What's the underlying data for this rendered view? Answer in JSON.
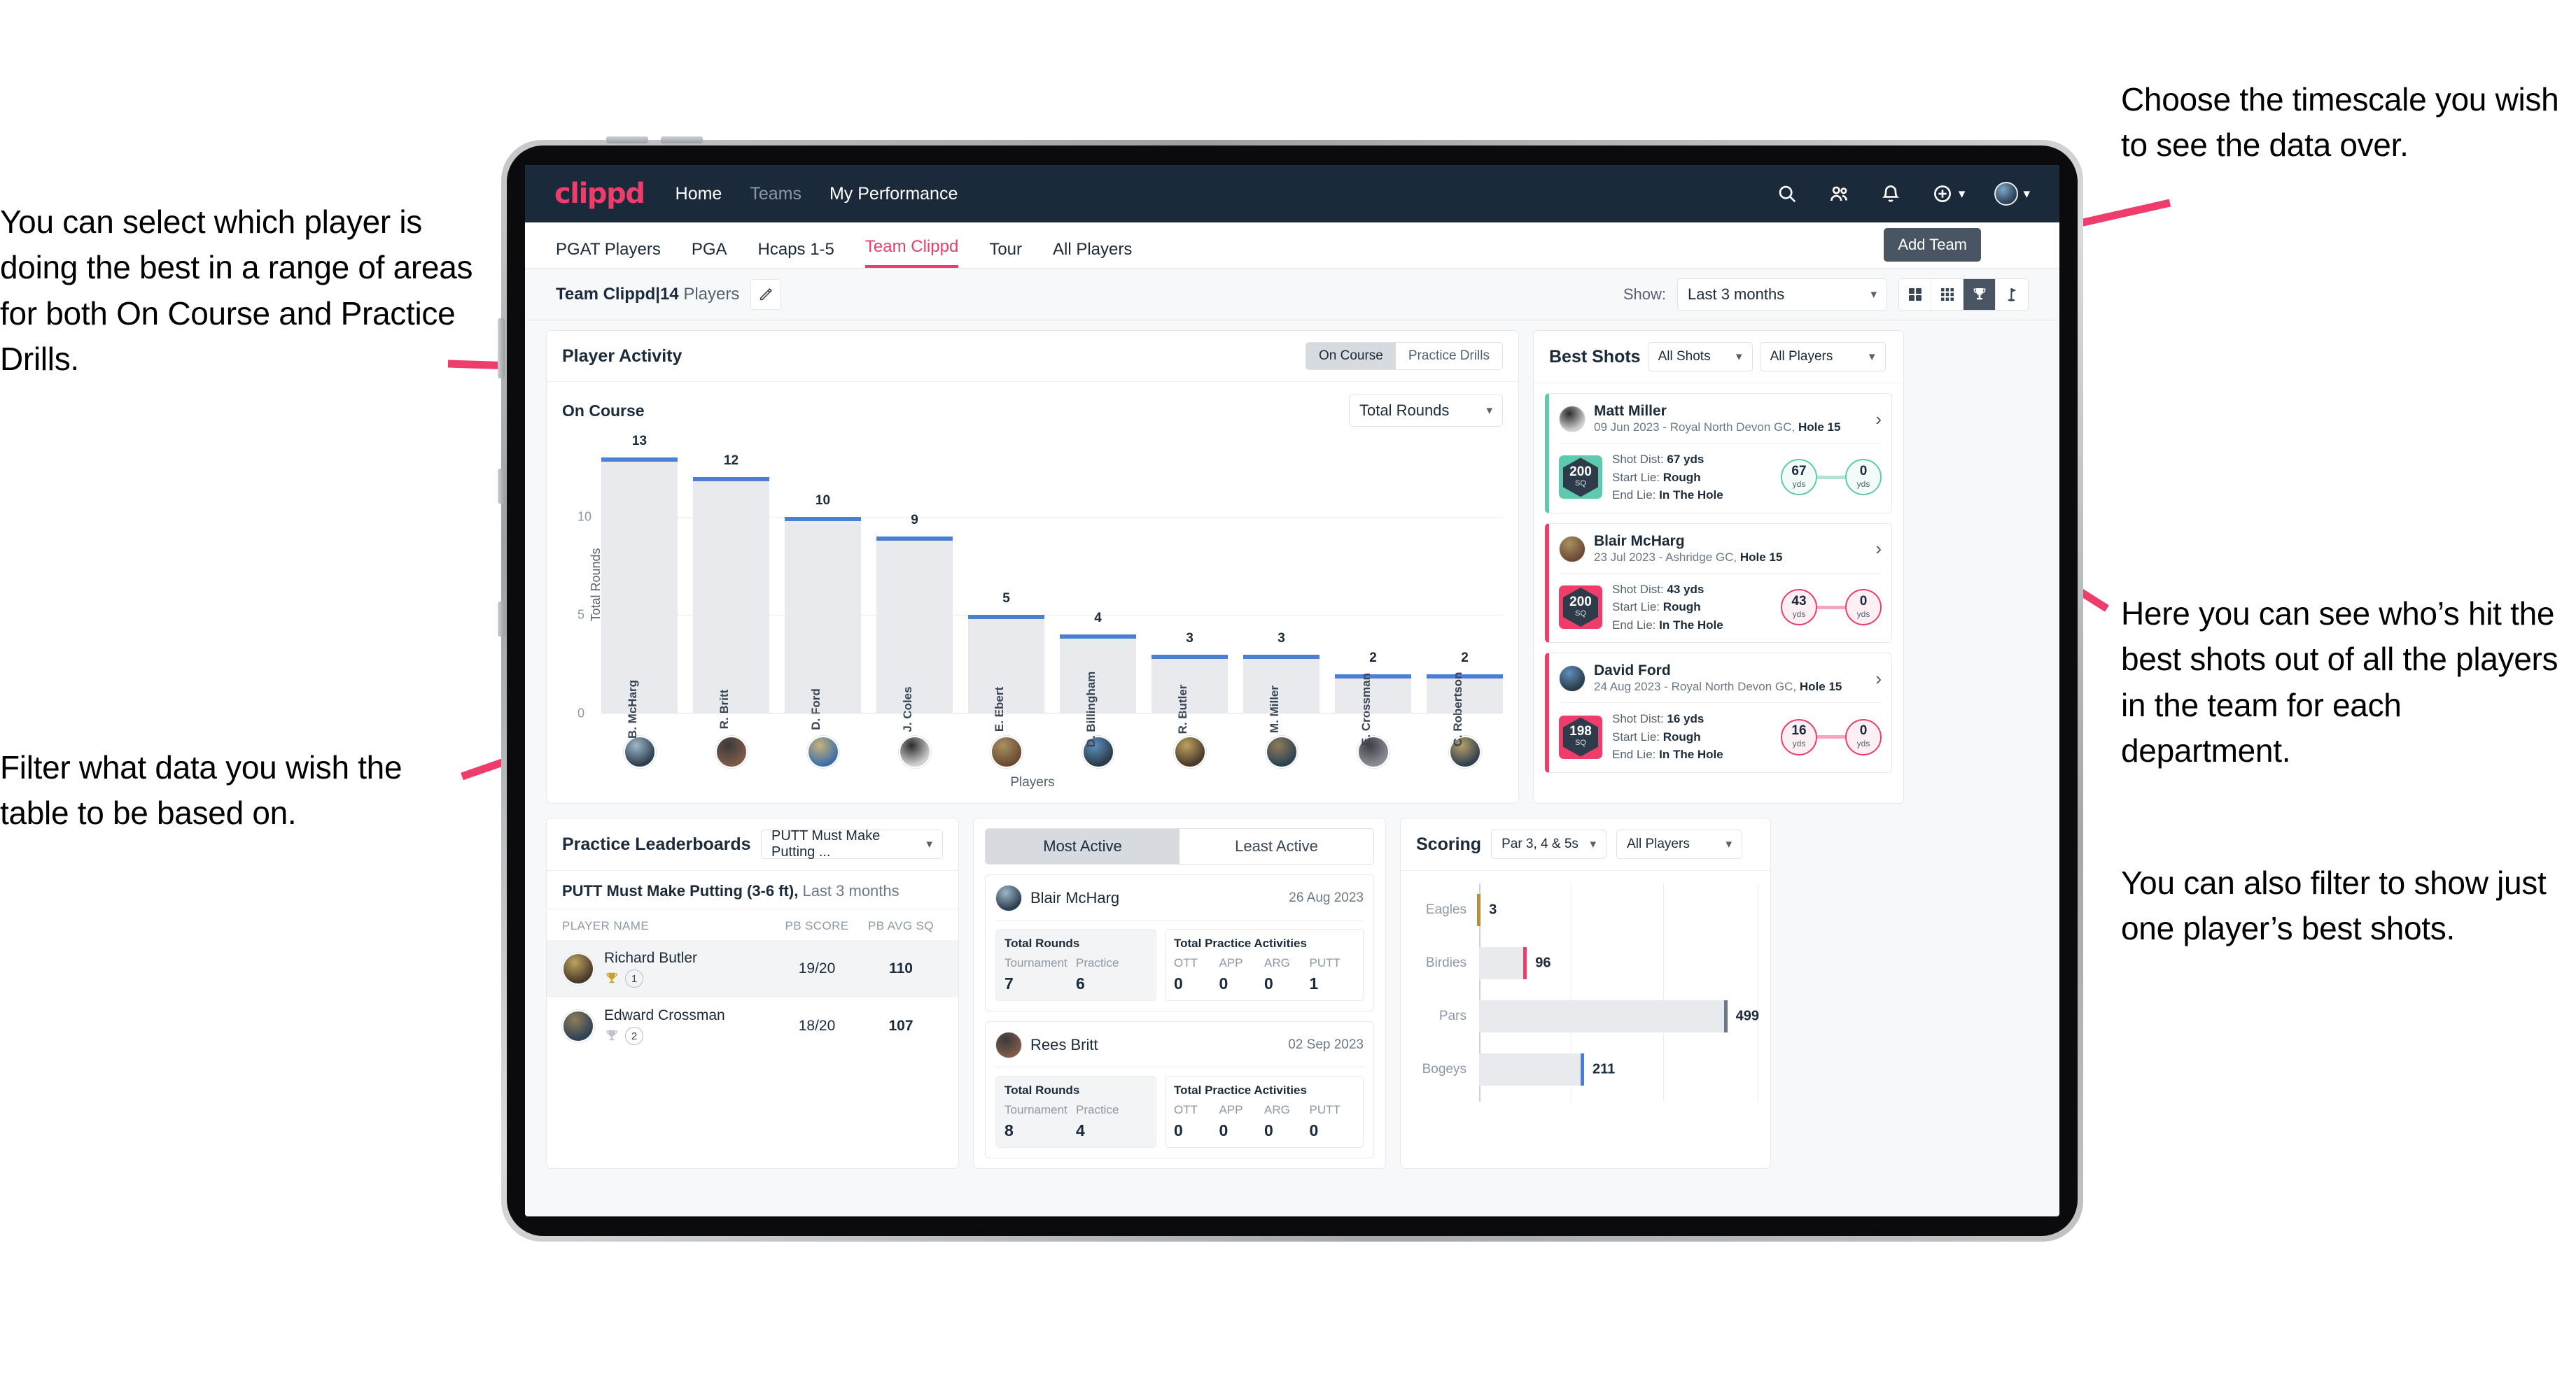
{
  "annotations": {
    "left_top": "You can select which player is doing the best in a range of areas for both On Course and Practice Drills.",
    "left_bottom": "Filter what data you wish the table to be based on.",
    "right_top": "Choose the timescale you wish to see the data over.",
    "right_middle": "Here you can see who’s hit the best shots out of all the players in the team for each department.",
    "right_bottom": "You can also filter to show just one player’s best shots."
  },
  "topnav": {
    "brand": "clippd",
    "links": [
      {
        "label": "Home",
        "active": true
      },
      {
        "label": "Teams",
        "active": false
      },
      {
        "label": "My Performance",
        "active": true
      }
    ],
    "icons": [
      "search-icon",
      "people-icon",
      "bell-icon",
      "plus-circle-icon",
      "avatar"
    ]
  },
  "subtabs": {
    "items": [
      {
        "label": "PGAT Players",
        "state": "normal"
      },
      {
        "label": "PGA",
        "state": "normal"
      },
      {
        "label": "Hcaps 1-5",
        "state": "normal"
      },
      {
        "label": "Team Clippd",
        "state": "active"
      },
      {
        "label": "Tour",
        "state": "normal"
      },
      {
        "label": "All Players",
        "state": "normal"
      }
    ],
    "tooltip": "Add Team"
  },
  "teambar": {
    "team_name": "Team Clippd",
    "separator": "|",
    "player_count": "14",
    "players_word": "Players",
    "edit_icon": "pencil-icon",
    "show_label": "Show:",
    "timescale_value": "Last 3 months",
    "view_icons": [
      "grid-large-icon",
      "grid-small-icon",
      "trophy-icon",
      "flag-icon"
    ],
    "active_view": "trophy-icon"
  },
  "player_activity": {
    "title": "Player Activity",
    "segments": [
      {
        "label": "On Course",
        "active": true
      },
      {
        "label": "Practice Drills",
        "active": false
      }
    ],
    "sub_label": "On Course",
    "metric_select": "Total Rounds"
  },
  "chart_data": {
    "type": "bar",
    "title": "Player Activity - On Course",
    "xlabel": "Players",
    "ylabel": "Total Rounds",
    "categories": [
      "B. McHarg",
      "R. Britt",
      "D. Ford",
      "J. Coles",
      "E. Ebert",
      "D. Billingham",
      "R. Butler",
      "M. Miller",
      "E. Crossman",
      "C. Robertson"
    ],
    "values": [
      13,
      12,
      10,
      9,
      5,
      4,
      3,
      3,
      2,
      2
    ],
    "yticks": [
      0,
      5,
      10
    ],
    "ylim": [
      0,
      14
    ],
    "grid": true,
    "legend": "none",
    "bar_color": "#e8eaee",
    "cap_color": "#4a7fd4"
  },
  "best_shots": {
    "title": "Best Shots",
    "filter_shots": "All Shots",
    "filter_players": "All Players",
    "shots": [
      {
        "player": "Matt Miller",
        "meta_date": "09 Jun 2023",
        "meta_course": "Royal North Devon GC,",
        "meta_hole": "Hole 15",
        "sq": "200",
        "sq_unit": "SQ",
        "shot_dist_label": "Shot Dist:",
        "shot_dist": "67 yds",
        "start_lie_label": "Start Lie:",
        "start_lie": "Rough",
        "end_lie_label": "End Lie:",
        "end_lie": "In The Hole",
        "from_value": "67",
        "from_unit": "yds",
        "to_value": "0",
        "to_unit": "yds",
        "accent": "#5fc9ad"
      },
      {
        "player": "Blair McHarg",
        "meta_date": "23 Jul 2023",
        "meta_course": "Ashridge GC,",
        "meta_hole": "Hole 15",
        "sq": "200",
        "sq_unit": "SQ",
        "shot_dist_label": "Shot Dist:",
        "shot_dist": "43 yds",
        "start_lie_label": "Start Lie:",
        "start_lie": "Rough",
        "end_lie_label": "End Lie:",
        "end_lie": "In The Hole",
        "from_value": "43",
        "from_unit": "yds",
        "to_value": "0",
        "to_unit": "yds",
        "accent": "#ee3c6b"
      },
      {
        "player": "David Ford",
        "meta_date": "24 Aug 2023",
        "meta_course": "Royal North Devon GC,",
        "meta_hole": "Hole 15",
        "sq": "198",
        "sq_unit": "SQ",
        "shot_dist_label": "Shot Dist:",
        "shot_dist": "16 yds",
        "start_lie_label": "Start Lie:",
        "start_lie": "Rough",
        "end_lie_label": "End Lie:",
        "end_lie": "In The Hole",
        "from_value": "16",
        "from_unit": "yds",
        "to_value": "0",
        "to_unit": "yds",
        "accent": "#ee3c6b"
      }
    ]
  },
  "practice_leaderboards": {
    "title": "Practice Leaderboards",
    "drill_select": "PUTT Must Make Putting ...",
    "sub_title": "PUTT Must Make Putting (3-6 ft),",
    "sub_period": "Last 3 months",
    "columns": [
      "PLAYER NAME",
      "PB SCORE",
      "PB AVG SQ"
    ],
    "rows": [
      {
        "name": "Richard Butler",
        "rank": "1",
        "trophy": "gold",
        "pb_score": "19/20",
        "pb_avg_sq": "110"
      },
      {
        "name": "Edward Crossman",
        "rank": "2",
        "trophy": "silver",
        "pb_score": "18/20",
        "pb_avg_sq": "107"
      }
    ]
  },
  "activity": {
    "tabs": [
      {
        "label": "Most Active",
        "active": true
      },
      {
        "label": "Least Active",
        "active": false
      }
    ],
    "cards": [
      {
        "player": "Blair McHarg",
        "date": "26 Aug 2023",
        "rounds_title": "Total Rounds",
        "rounds": [
          {
            "key": "Tournament",
            "value": "7"
          },
          {
            "key": "Practice",
            "value": "6"
          }
        ],
        "practice_title": "Total Practice Activities",
        "practice": [
          {
            "key": "OTT",
            "value": "0"
          },
          {
            "key": "APP",
            "value": "0"
          },
          {
            "key": "ARG",
            "value": "0"
          },
          {
            "key": "PUTT",
            "value": "1"
          }
        ]
      },
      {
        "player": "Rees Britt",
        "date": "02 Sep 2023",
        "rounds_title": "Total Rounds",
        "rounds": [
          {
            "key": "Tournament",
            "value": "8"
          },
          {
            "key": "Practice",
            "value": "4"
          }
        ],
        "practice_title": "Total Practice Activities",
        "practice": [
          {
            "key": "OTT",
            "value": "0"
          },
          {
            "key": "APP",
            "value": "0"
          },
          {
            "key": "ARG",
            "value": "0"
          },
          {
            "key": "PUTT",
            "value": "0"
          }
        ]
      }
    ]
  },
  "scoring": {
    "title": "Scoring",
    "filter_par": "Par 3, 4 & 5s",
    "filter_players": "All Players",
    "chart": {
      "type": "bar",
      "orientation": "horizontal",
      "categories": [
        "Eagles",
        "Birdies",
        "Pars",
        "Bogeys"
      ],
      "values": [
        3,
        96,
        499,
        211
      ],
      "xlim": [
        0,
        560
      ],
      "colors": [
        "#b78f3d",
        "#ee3c6b",
        "#6c7885",
        "#4a7fd4"
      ],
      "grid": true
    }
  },
  "colors": {
    "brand_pink": "#ee3c6b",
    "nav_dark": "#1b2a3a",
    "teal": "#5fc9ad",
    "bar_blue": "#4a7fd4"
  }
}
